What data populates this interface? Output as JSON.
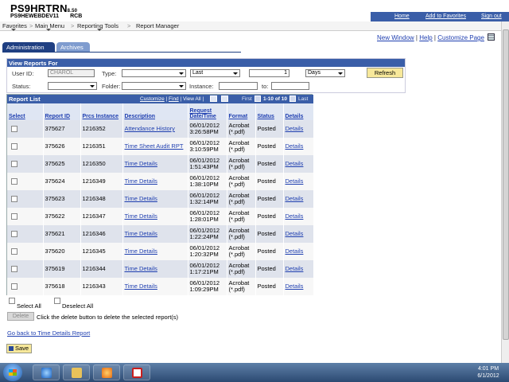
{
  "header": {
    "title": "PS9HRTRN",
    "version": "8.50",
    "server": "PS9HEWEBDEV11",
    "user_code": "RCB",
    "links": [
      "Home",
      "Add to Favorites",
      "Sign out"
    ]
  },
  "menu": {
    "items": [
      "Favorites",
      "Main Menu",
      "Reporting Tools",
      "Report Manager"
    ],
    "separator": ">"
  },
  "page_links": [
    "New Window",
    "Help",
    "Customize Page"
  ],
  "page_links_sep": "|",
  "tabs": [
    "Administration",
    "Archives"
  ],
  "view_reports": {
    "title": "View Reports For",
    "user_id_label": "User ID:",
    "user_id_value": "CHAROL",
    "type_label": "Type:",
    "type_value": "",
    "last_value": "Last",
    "last_number": "1",
    "days_value": "Days",
    "refresh_label": "Refresh",
    "status_label": "Status:",
    "status_value": "",
    "folder_label": "Folder:",
    "folder_value": "",
    "instance_label": "Instance:",
    "instance_from": "",
    "to_label": "to:",
    "instance_to": ""
  },
  "report_list": {
    "title": "Report List",
    "customize": "Customize",
    "find": "Find",
    "view_all": "View All",
    "first": "First",
    "range": "1-10 of 10",
    "last": "Last",
    "columns": [
      "Select",
      "Report ID",
      "Prcs Instance",
      "Description",
      "Request Date/Time",
      "Format",
      "Status",
      "Details"
    ],
    "rows": [
      {
        "report_id": "375627",
        "prcs": "1216352",
        "description": "Attendance History",
        "date": "06/01/2012",
        "time": "3:26:58PM",
        "format1": "Acrobat",
        "format2": "(*.pdf)",
        "status": "Posted",
        "details": "Details"
      },
      {
        "report_id": "375626",
        "prcs": "1216351",
        "description": "Time Sheet Audit RPT",
        "date": "06/01/2012",
        "time": "3:10:59PM",
        "format1": "Acrobat",
        "format2": "(*.pdf)",
        "status": "Posted",
        "details": "Details"
      },
      {
        "report_id": "375625",
        "prcs": "1216350",
        "description": "Time Details",
        "date": "06/01/2012",
        "time": "1:51:43PM",
        "format1": "Acrobat",
        "format2": "(*.pdf)",
        "status": "Posted",
        "details": "Details"
      },
      {
        "report_id": "375624",
        "prcs": "1216349",
        "description": "Time Details",
        "date": "06/01/2012",
        "time": "1:38:10PM",
        "format1": "Acrobat",
        "format2": "(*.pdf)",
        "status": "Posted",
        "details": "Details"
      },
      {
        "report_id": "375623",
        "prcs": "1216348",
        "description": "Time Details",
        "date": "06/01/2012",
        "time": "1:32:14PM",
        "format1": "Acrobat",
        "format2": "(*.pdf)",
        "status": "Posted",
        "details": "Details"
      },
      {
        "report_id": "375622",
        "prcs": "1216347",
        "description": "Time Details",
        "date": "06/01/2012",
        "time": "1:28:01PM",
        "format1": "Acrobat",
        "format2": "(*.pdf)",
        "status": "Posted",
        "details": "Details"
      },
      {
        "report_id": "375621",
        "prcs": "1216346",
        "description": "Time Details",
        "date": "06/01/2012",
        "time": "1:22:24PM",
        "format1": "Acrobat",
        "format2": "(*.pdf)",
        "status": "Posted",
        "details": "Details"
      },
      {
        "report_id": "375620",
        "prcs": "1216345",
        "description": "Time Details",
        "date": "06/01/2012",
        "time": "1:20:32PM",
        "format1": "Acrobat",
        "format2": "(*.pdf)",
        "status": "Posted",
        "details": "Details"
      },
      {
        "report_id": "375619",
        "prcs": "1216344",
        "description": "Time Details",
        "date": "06/01/2012",
        "time": "1:17:21PM",
        "format1": "Acrobat",
        "format2": "(*.pdf)",
        "status": "Posted",
        "details": "Details"
      },
      {
        "report_id": "375618",
        "prcs": "1216343",
        "description": "Time Details",
        "date": "06/01/2012",
        "time": "1:09:29PM",
        "format1": "Acrobat",
        "format2": "(*.pdf)",
        "status": "Posted",
        "details": "Details"
      }
    ]
  },
  "footer": {
    "select_all": "Select All",
    "deselect_all": "Deselect All",
    "delete_label": "Delete",
    "delete_note": "Click the delete button to delete the selected report(s)",
    "go_back": "Go back to Time Details Report",
    "save_label": "Save"
  },
  "taskbar": {
    "time": "4:01 PM",
    "date": "6/1/2012"
  },
  "colors": {
    "header_blue": "#3a5ea8",
    "tab_active": "#1f3f82",
    "link": "#1f3fb0",
    "button_yellow": "#f7e89a"
  }
}
